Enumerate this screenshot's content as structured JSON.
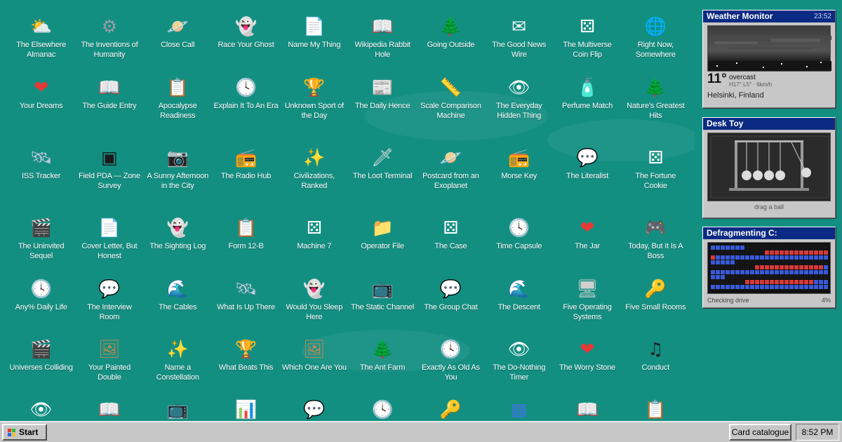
{
  "desktop": {
    "icons": [
      {
        "label": "The Elsewhere Almanac",
        "icon": "sun-cloud-icon",
        "glyph": "⛅",
        "color": "#f4c430"
      },
      {
        "label": "The Inventions of Humanity",
        "icon": "gear-icon",
        "glyph": "⚙",
        "color": "#9aa0a6"
      },
      {
        "label": "Close Call",
        "icon": "planet-icon",
        "glyph": "🪐",
        "color": "#b59bff"
      },
      {
        "label": "Race Your Ghost",
        "icon": "ghost-icon",
        "glyph": "👻",
        "color": "#ffffff"
      },
      {
        "label": "Name My Thing",
        "icon": "document-icon",
        "glyph": "📄",
        "color": "#ffffff"
      },
      {
        "label": "Wikipedia Rabbit Hole",
        "icon": "open-book-icon",
        "glyph": "📖",
        "color": "#ffffff"
      },
      {
        "label": "Going Outside",
        "icon": "pine-tree-icon",
        "glyph": "🌲",
        "color": "#2e7d32"
      },
      {
        "label": "The Good News Wire",
        "icon": "envelope-icon",
        "glyph": "✉",
        "color": "#ffffff"
      },
      {
        "label": "The Multiverse Coin Flip",
        "icon": "dice-icon",
        "glyph": "⚄",
        "color": "#ffffff"
      },
      {
        "label": "Right Now, Somewhere",
        "icon": "globe-icon",
        "glyph": "🌐",
        "color": "#7fd6d0"
      },
      {
        "label": "Your Dreams",
        "icon": "heart-icon",
        "glyph": "❤",
        "color": "#e53935"
      },
      {
        "label": "The Guide Entry",
        "icon": "open-book-icon",
        "glyph": "📖",
        "color": "#ffffff"
      },
      {
        "label": "Apocalypse Readiness",
        "icon": "clipboard-icon",
        "glyph": "📋",
        "color": "#e8d8b0"
      },
      {
        "label": "Explain It To An Era",
        "icon": "clock-icon",
        "glyph": "🕓",
        "color": "#ffffff"
      },
      {
        "label": "Unknown Sport of the Day",
        "icon": "trophy-icon",
        "glyph": "🏆",
        "color": "#f0b400"
      },
      {
        "label": "The Daily Hence",
        "icon": "newspaper-icon",
        "glyph": "📰",
        "color": "#e0e0e0"
      },
      {
        "label": "Scale Comparison Machine",
        "icon": "ruler-icon",
        "glyph": "📏",
        "color": "#f0c020"
      },
      {
        "label": "The Everyday Hidden Thing",
        "icon": "eye-icon",
        "glyph": "👁",
        "color": "#ffffff"
      },
      {
        "label": "Perfume Match",
        "icon": "perfume-bottle-icon",
        "glyph": "🧴",
        "color": "#c8a0e8"
      },
      {
        "label": "Nature's Greatest Hits",
        "icon": "pine-tree-icon",
        "glyph": "🌲",
        "color": "#2e7d32"
      },
      {
        "label": "ISS Tracker",
        "icon": "satellite-icon",
        "glyph": "🛰",
        "color": "#c0c8d8"
      },
      {
        "label": "Field PDA — Zone Survey",
        "icon": "terminal-icon",
        "glyph": "▣",
        "color": "#1a1a1a"
      },
      {
        "label": "A Sunny Afternoon in the City",
        "icon": "camera-icon",
        "glyph": "📷",
        "color": "#333333"
      },
      {
        "label": "The Radio Hub",
        "icon": "radio-icon",
        "glyph": "📻",
        "color": "#8d6e63"
      },
      {
        "label": "Civilizations, Ranked",
        "icon": "sparkle-icon",
        "glyph": "✨",
        "color": "#fff176"
      },
      {
        "label": "The Loot Terminal",
        "icon": "sword-icon",
        "glyph": "🗡",
        "color": "#e0e0e0"
      },
      {
        "label": "Postcard from an Exoplanet",
        "icon": "planet-icon",
        "glyph": "🪐",
        "color": "#b59bff"
      },
      {
        "label": "Morse Key",
        "icon": "radio-icon",
        "glyph": "📻",
        "color": "#8d6e63"
      },
      {
        "label": "The Literalist",
        "icon": "chat-bubbles-icon",
        "glyph": "💬",
        "color": "#ffffff"
      },
      {
        "label": "The Fortune Cookie",
        "icon": "dice-icon",
        "glyph": "⚄",
        "color": "#ffffff"
      },
      {
        "label": "The Uninvited Sequel",
        "icon": "clapperboard-icon",
        "glyph": "🎬",
        "color": "#222222"
      },
      {
        "label": "Cover Letter, But Honest",
        "icon": "document-icon",
        "glyph": "📄",
        "color": "#ffffff"
      },
      {
        "label": "The Sighting Log",
        "icon": "ghost-icon",
        "glyph": "👻",
        "color": "#ffffff"
      },
      {
        "label": "Form 12-B",
        "icon": "clipboard-icon",
        "glyph": "📋",
        "color": "#e8d8b0"
      },
      {
        "label": "Machine 7",
        "icon": "dice-icon",
        "glyph": "⚄",
        "color": "#ffffff"
      },
      {
        "label": "Operator File",
        "icon": "folder-icon",
        "glyph": "📁",
        "color": "#f0c040"
      },
      {
        "label": "The Case",
        "icon": "dice-icon",
        "glyph": "⚄",
        "color": "#ffffff"
      },
      {
        "label": "Time Capsule",
        "icon": "clock-icon",
        "glyph": "🕓",
        "color": "#ffffff"
      },
      {
        "label": "The Jar",
        "icon": "heart-icon",
        "glyph": "❤",
        "color": "#e53935"
      },
      {
        "label": "Today, But It Is A Boss",
        "icon": "gamepad-icon",
        "glyph": "🎮",
        "color": "#c0c0c0"
      },
      {
        "label": "Any% Daily Life",
        "icon": "clock-icon",
        "glyph": "🕓",
        "color": "#ffffff"
      },
      {
        "label": "The Interview Room",
        "icon": "chat-bubbles-icon",
        "glyph": "💬",
        "color": "#ffffff"
      },
      {
        "label": "The Cables",
        "icon": "waves-icon",
        "glyph": "🌊",
        "color": "#4fc3f7"
      },
      {
        "label": "What Is Up There",
        "icon": "satellite-icon",
        "glyph": "🛰",
        "color": "#c0c8d8"
      },
      {
        "label": "Would You Sleep Here",
        "icon": "ghost-icon",
        "glyph": "👻",
        "color": "#ffffff"
      },
      {
        "label": "The Static Channel",
        "icon": "tv-icon",
        "glyph": "📺",
        "color": "#8d6e63"
      },
      {
        "label": "The Group Chat",
        "icon": "chat-bubbles-icon",
        "glyph": "💬",
        "color": "#ffffff"
      },
      {
        "label": "The Descent",
        "icon": "waves-icon",
        "glyph": "🌊",
        "color": "#4fc3f7"
      },
      {
        "label": "Five Operating Systems",
        "icon": "computer-monitor-icon",
        "glyph": "🖥",
        "color": "#d0d0d0"
      },
      {
        "label": "Five Small Rooms",
        "icon": "key-icon",
        "glyph": "🔑",
        "color": "#f0b400"
      },
      {
        "label": "Universes Colliding",
        "icon": "clapperboard-icon",
        "glyph": "🎬",
        "color": "#222222"
      },
      {
        "label": "Your Painted Double",
        "icon": "framed-portrait-icon",
        "glyph": "🖼",
        "color": "#c08850"
      },
      {
        "label": "Name a Constellation",
        "icon": "sparkle-icon",
        "glyph": "✨",
        "color": "#fff176"
      },
      {
        "label": "What Beats This",
        "icon": "trophy-icon",
        "glyph": "🏆",
        "color": "#f0b400"
      },
      {
        "label": "Which One Are You",
        "icon": "framed-portrait-icon",
        "glyph": "🖼",
        "color": "#c08850"
      },
      {
        "label": "The Ant Farm",
        "icon": "pine-tree-icon",
        "glyph": "🌲",
        "color": "#2e7d32"
      },
      {
        "label": "Exactly As Old As You",
        "icon": "clock-icon",
        "glyph": "🕓",
        "color": "#ffffff"
      },
      {
        "label": "The Do-Nothing Timer",
        "icon": "eye-icon",
        "glyph": "👁",
        "color": "#ffffff"
      },
      {
        "label": "The Worry Stone",
        "icon": "heart-icon",
        "glyph": "❤",
        "color": "#e53935"
      },
      {
        "label": "Conduct",
        "icon": "music-note-icon",
        "glyph": "♫",
        "color": "#1e1e1e"
      },
      {
        "label": "",
        "icon": "eye-icon",
        "glyph": "👁",
        "color": "#ffffff"
      },
      {
        "label": "",
        "icon": "open-book-icon",
        "glyph": "📖",
        "color": "#ffffff"
      },
      {
        "label": "",
        "icon": "tv-icon",
        "glyph": "📺",
        "color": "#8d6e63"
      },
      {
        "label": "",
        "icon": "bar-chart-icon",
        "glyph": "📊",
        "color": "#ffffff"
      },
      {
        "label": "",
        "icon": "chat-bubbles-icon",
        "glyph": "💬",
        "color": "#ffffff"
      },
      {
        "label": "",
        "icon": "clock-icon",
        "glyph": "🕓",
        "color": "#ffffff"
      },
      {
        "label": "",
        "icon": "key-icon",
        "glyph": "🔑",
        "color": "#f0b400"
      },
      {
        "label": "",
        "icon": "windows-flag-icon",
        "glyph": "▦",
        "color": "#3a78d8"
      },
      {
        "label": "",
        "icon": "open-book-icon",
        "glyph": "📖",
        "color": "#ffffff"
      },
      {
        "label": "",
        "icon": "clipboard-icon",
        "glyph": "📋",
        "color": "#e8d8b0"
      }
    ]
  },
  "weather": {
    "title": "Weather Monitor",
    "time": "23:52",
    "temperature": "11°",
    "condition": "overcast",
    "details": "H17° L5° · 6km/h",
    "location": "Helsinki, Finland"
  },
  "desk_toy": {
    "title": "Desk Toy",
    "caption": "drag a ball"
  },
  "defrag": {
    "title": "Defragmenting C:",
    "status": "Checking drive",
    "percent": "4%",
    "progress": 0.04,
    "colors": {
      "used": "#3a5ad8",
      "fragmented": "#d83a3a",
      "free": "#161616"
    }
  },
  "taskbar": {
    "start_label": "Start",
    "open_window": "Card catalogue",
    "clock": "8:52 PM"
  },
  "colors": {
    "desktop": "#138f82",
    "titlebar": "#0a2a83",
    "chrome": "#c7c7c7"
  }
}
